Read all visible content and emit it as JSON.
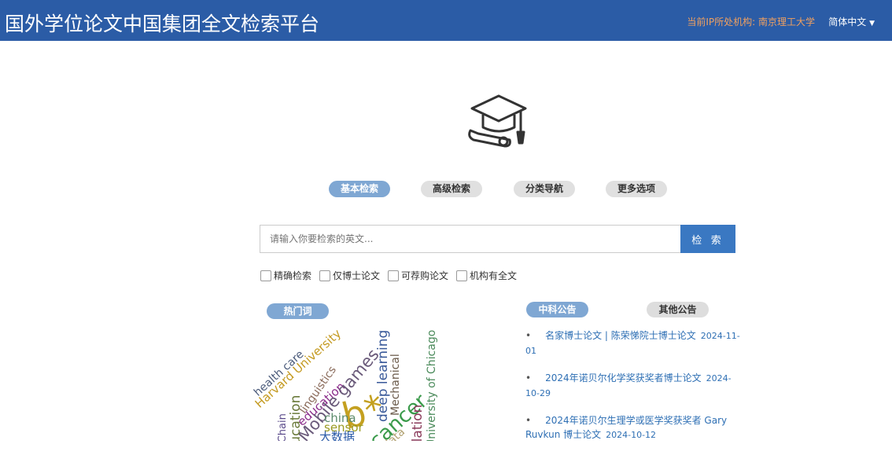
{
  "header": {
    "title": "国外学位论文中国集团全文检索平台",
    "institution": "当前IP所处机构: 南京理工大学",
    "language": "简体中文"
  },
  "tabs": [
    {
      "label": "基本检索",
      "active": true
    },
    {
      "label": "高级检索"
    },
    {
      "label": "分类导航"
    },
    {
      "label": "更多选项"
    }
  ],
  "search": {
    "placeholder": "请输入你要检索的英文...",
    "button": "检 索"
  },
  "options": [
    "精确检索",
    "仅博士论文",
    "可荐购论文",
    "机构有全文"
  ],
  "hotwords": {
    "label": "热门词",
    "words": [
      "health care",
      "Harvard University",
      "linguistics",
      "education",
      "Mobile games",
      "education",
      "ckChain",
      "deep learning",
      "Mechanical",
      "b*",
      "ng cancer",
      "University of Chicago",
      "nslation",
      "china",
      "sensor",
      "大数据",
      "data"
    ]
  },
  "notices": {
    "tabs": [
      "中科公告",
      "其他公告"
    ],
    "items": [
      {
        "title": "名家博士论文 | 陈荣悌院士博士论文",
        "date": "2024-11-01"
      },
      {
        "title": "2024年诺贝尔化学奖获奖者博士论文",
        "date": "2024-10-29"
      },
      {
        "title": "2024年诺贝尔生理学或医学奖获奖者 Gary Ruvkun 博士论文",
        "date": "2024-10-12"
      }
    ]
  }
}
